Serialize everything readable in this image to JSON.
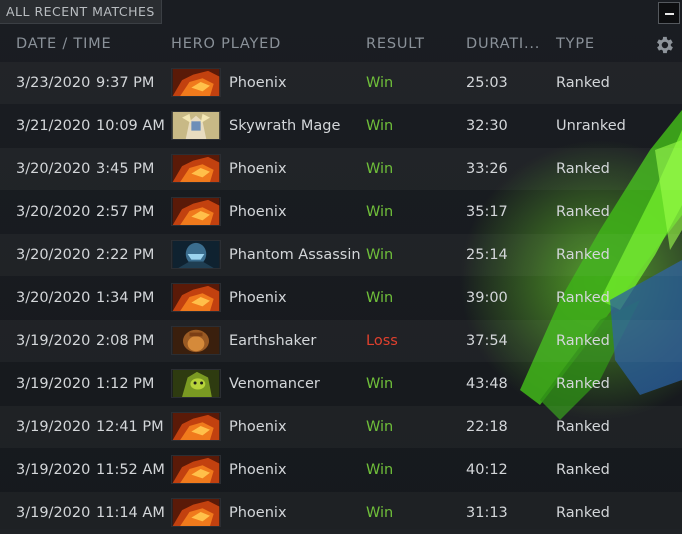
{
  "panel": {
    "title": "ALL RECENT MATCHES",
    "minimize_icon": "minus-icon",
    "settings_icon": "gear-icon"
  },
  "columns": {
    "date_time": "DATE / TIME",
    "hero": "HERO PLAYED",
    "result": "RESULT",
    "duration": "DURATI...",
    "type": "TYPE"
  },
  "colors": {
    "win": "#6fbf3a",
    "loss": "#e0402e",
    "header_text": "#8a9199",
    "accent_green": "#5bd61e"
  },
  "matches": [
    {
      "date": "3/23/2020",
      "time": "9:37 PM",
      "hero": "Phoenix",
      "portrait": "phoenix",
      "result": "Win",
      "duration": "25:03",
      "type": "Ranked"
    },
    {
      "date": "3/21/2020",
      "time": "10:09 AM",
      "hero": "Skywrath Mage",
      "portrait": "skywrath",
      "result": "Win",
      "duration": "32:30",
      "type": "Unranked"
    },
    {
      "date": "3/20/2020",
      "time": "3:45 PM",
      "hero": "Phoenix",
      "portrait": "phoenix",
      "result": "Win",
      "duration": "33:26",
      "type": "Ranked"
    },
    {
      "date": "3/20/2020",
      "time": "2:57 PM",
      "hero": "Phoenix",
      "portrait": "phoenix",
      "result": "Win",
      "duration": "35:17",
      "type": "Ranked"
    },
    {
      "date": "3/20/2020",
      "time": "2:22 PM",
      "hero": "Phantom Assassin",
      "portrait": "phantom",
      "result": "Win",
      "duration": "25:14",
      "type": "Ranked"
    },
    {
      "date": "3/20/2020",
      "time": "1:34 PM",
      "hero": "Phoenix",
      "portrait": "phoenix",
      "result": "Win",
      "duration": "39:00",
      "type": "Ranked"
    },
    {
      "date": "3/19/2020",
      "time": "2:08 PM",
      "hero": "Earthshaker",
      "portrait": "earthshaker",
      "result": "Loss",
      "duration": "37:54",
      "type": "Ranked"
    },
    {
      "date": "3/19/2020",
      "time": "1:12 PM",
      "hero": "Venomancer",
      "portrait": "venomancer",
      "result": "Win",
      "duration": "43:48",
      "type": "Ranked"
    },
    {
      "date": "3/19/2020",
      "time": "12:41 PM",
      "hero": "Phoenix",
      "portrait": "phoenix",
      "result": "Win",
      "duration": "22:18",
      "type": "Ranked"
    },
    {
      "date": "3/19/2020",
      "time": "11:52 AM",
      "hero": "Phoenix",
      "portrait": "phoenix",
      "result": "Win",
      "duration": "40:12",
      "type": "Ranked"
    },
    {
      "date": "3/19/2020",
      "time": "11:14 AM",
      "hero": "Phoenix",
      "portrait": "phoenix",
      "result": "Win",
      "duration": "31:13",
      "type": "Ranked"
    }
  ]
}
